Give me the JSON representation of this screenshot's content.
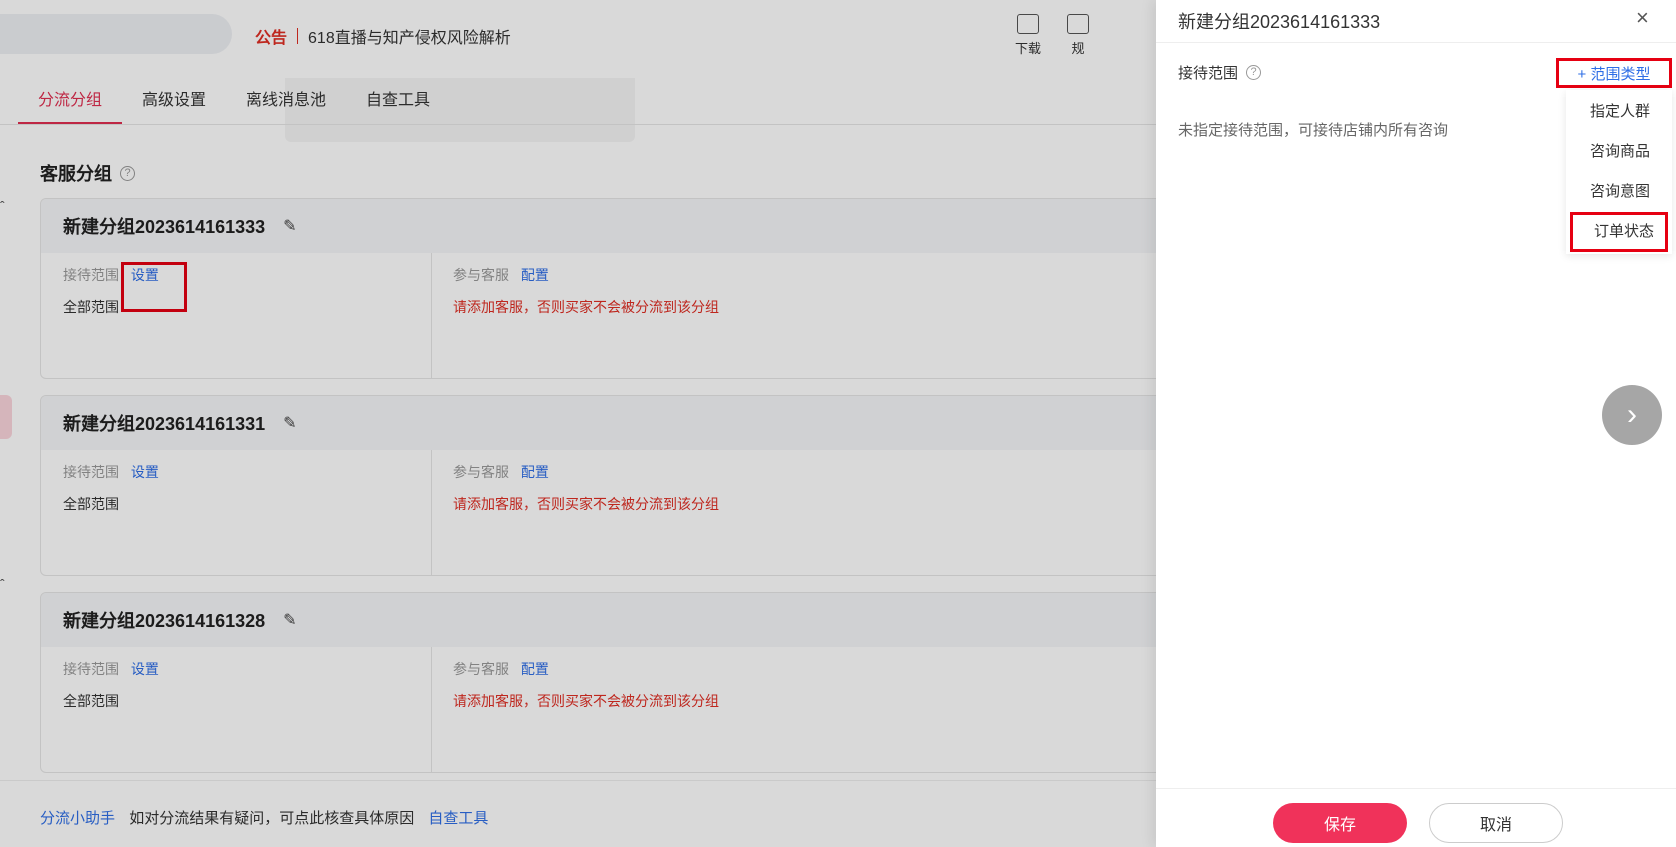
{
  "topbar": {
    "notice_tag": "公告",
    "notice_text": "618直播与知产侵权风险解析",
    "tools": [
      {
        "label": "下载",
        "icon": "download-icon"
      },
      {
        "label": "规",
        "icon": "rules-icon"
      }
    ]
  },
  "tabs": [
    {
      "label": "分流分组",
      "active": true
    },
    {
      "label": "高级设置",
      "active": false
    },
    {
      "label": "离线消息池",
      "active": false
    },
    {
      "label": "自查工具",
      "active": false
    }
  ],
  "section": {
    "title": "客服分组",
    "help": "?"
  },
  "groups": [
    {
      "name": "新建分组2023614161333",
      "scope_label": "接待范围",
      "scope_link": "设置",
      "scope_value": "全部范围",
      "staff_label": "参与客服",
      "staff_link": "配置",
      "staff_warning": "请添加客服，否则买家不会被分流到该分组"
    },
    {
      "name": "新建分组2023614161331",
      "scope_label": "接待范围",
      "scope_link": "设置",
      "scope_value": "全部范围",
      "staff_label": "参与客服",
      "staff_link": "配置",
      "staff_warning": "请添加客服，否则买家不会被分流到该分组"
    },
    {
      "name": "新建分组2023614161328",
      "scope_label": "接待范围",
      "scope_link": "设置",
      "scope_value": "全部范围",
      "staff_label": "参与客服",
      "staff_link": "配置",
      "staff_warning": "请添加客服，否则买家不会被分流到该分组"
    }
  ],
  "footer": {
    "assistant_link": "分流小助手",
    "text": "如对分流结果有疑问，可点此核查具体原因",
    "tool_link": "自查工具"
  },
  "drawer": {
    "title": "新建分组2023614161333",
    "close": "×",
    "scope_label": "接待范围",
    "scope_hint": "未指定接待范围，可接待店铺内所有咨询",
    "add_scope_label": "+ 范围类型",
    "dropdown": [
      "指定人群",
      "咨询商品",
      "咨询意图",
      "订单状态"
    ],
    "save_label": "保存",
    "cancel_label": "取消",
    "next_arrow": "›"
  },
  "colors": {
    "accent": "#f0325a",
    "link": "#2e6ee6",
    "warning": "#e02e24",
    "highlight_box": "#e60012"
  }
}
